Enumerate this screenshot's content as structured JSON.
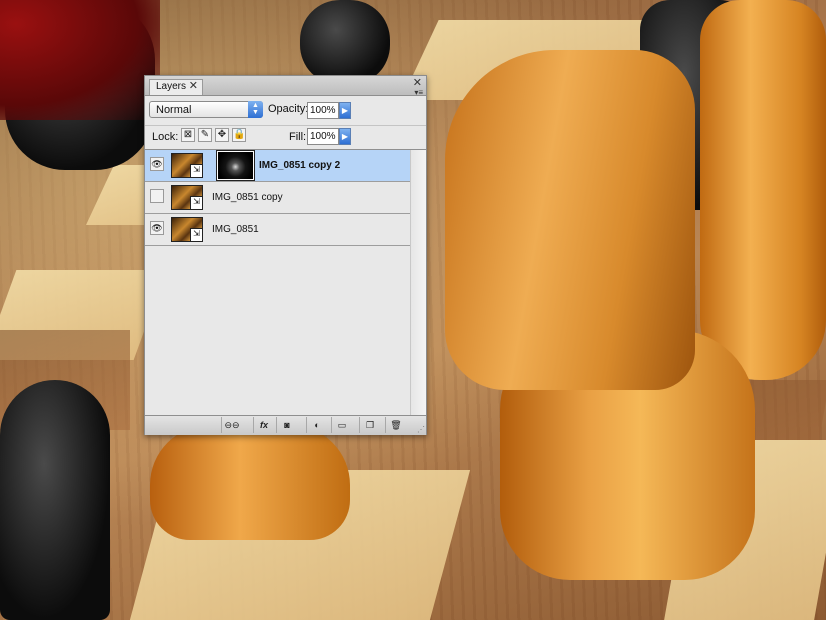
{
  "panel": {
    "tab_label": "Layers",
    "close_glyph": "✕",
    "menu_glyph": "▾≡",
    "blend_mode": "Normal",
    "opacity_label": "Opacity:",
    "opacity_value": "100%",
    "lock_label": "Lock:",
    "fill_label": "Fill:",
    "fill_value": "100%"
  },
  "icons": {
    "eye": "👁",
    "lock_transparent": "transparent-pixels-lock-icon",
    "lock_paint": "image-pixels-lock-icon",
    "lock_move": "position-lock-icon",
    "lock_all": "lock-all-icon"
  },
  "layers": [
    {
      "name": "IMG_0851 copy 2",
      "visible": true,
      "selected": true,
      "has_mask": true
    },
    {
      "name": "IMG_0851 copy",
      "visible": false,
      "selected": false,
      "has_mask": false
    },
    {
      "name": "IMG_0851",
      "visible": true,
      "selected": false,
      "has_mask": false
    }
  ],
  "bottom_buttons": [
    "link-layers",
    "add-layer-style",
    "add-layer-mask",
    "new-adjustment-layer",
    "new-group",
    "new-layer",
    "delete-layer"
  ],
  "bottom_labels": {
    "fx": "fx"
  },
  "colors": {
    "selection": "#b6d4f7",
    "accent": "#2e6fd3"
  }
}
